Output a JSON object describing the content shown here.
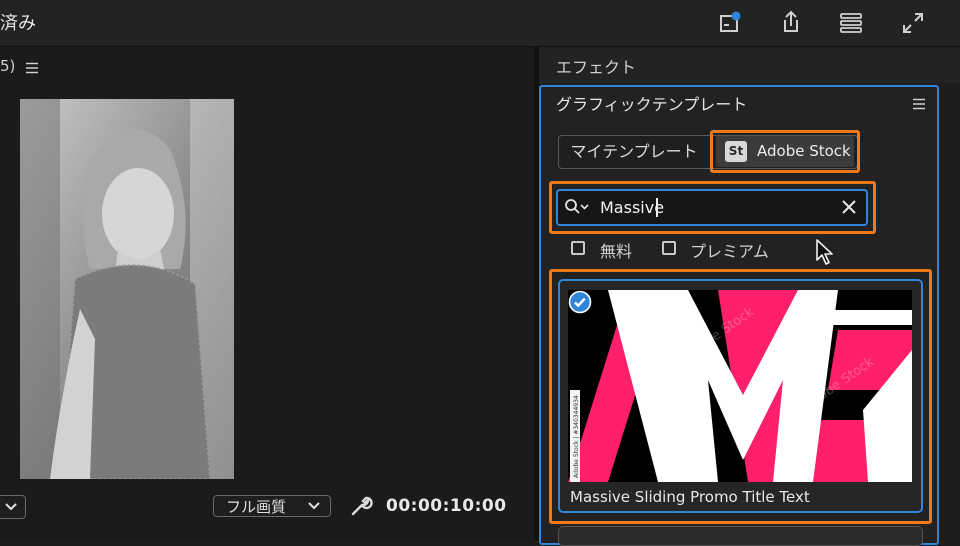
{
  "topbar": {
    "title": "済み",
    "icons": [
      "new-item-dot-icon",
      "share-upload-icon",
      "workspaces-icon",
      "fullscreen-icon"
    ],
    "accent": "#2f86d8"
  },
  "monitor": {
    "header_text": "5)",
    "quality_label": "フル画質",
    "timecode": "00:00:10:00"
  },
  "effects": {
    "tab_label": "エフェクト"
  },
  "graphics": {
    "title": "グラフィックテンプレート",
    "tabs": {
      "my_templates": "マイテンプレート",
      "stock_badge": "St",
      "stock": "Adobe Stock"
    },
    "search": {
      "value": "Massive"
    },
    "filters": {
      "free": "無料",
      "premium": "プレミアム"
    },
    "result": {
      "title": "Massive Sliding Promo Title Text",
      "watermark": "Adobe Stock",
      "side_text": "Adobe Stock | #340344934"
    }
  },
  "colors": {
    "highlight": "#f07a1a",
    "selection": "#2f86d8",
    "thumb_pink": "#ff1f6b"
  }
}
